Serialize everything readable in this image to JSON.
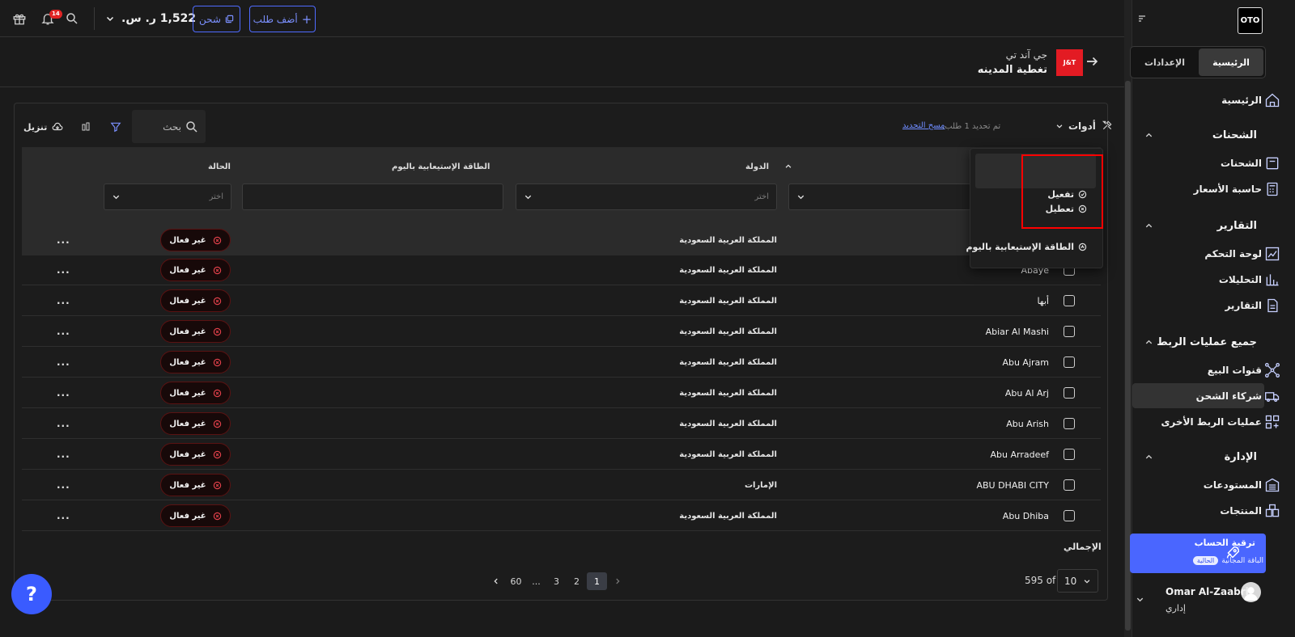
{
  "topbar": {
    "balance": "1,522 ر. س.",
    "ship_button": "شحن",
    "add_order_button": "أضف طلب",
    "notification_count": "14"
  },
  "carrier": {
    "logo_text": "J&T",
    "name": "جي آند تي",
    "page_title": "تغطية المدينه"
  },
  "toolbar": {
    "tools_label": "أدوات",
    "updated_text": "تم تحديد 1 طلب.",
    "clear_selection": "مسح التحديد",
    "search_placeholder": "بحث",
    "download_label": "تنزيل"
  },
  "table": {
    "headers": {
      "country": "الدولة",
      "capacity": "الطاقة الإستيعابية باليوم",
      "status": "الحالة"
    },
    "filter_placeholder": "اختر",
    "rows": [
      {
        "city": "",
        "country": "المملكة العربية السعودية",
        "status": "غير فعال"
      },
      {
        "city": "Abaye",
        "country": "المملكة العربية السعودية",
        "status": "غير فعال"
      },
      {
        "city": "أبها",
        "country": "المملكة العربية السعودية",
        "status": "غير فعال"
      },
      {
        "city": "Abiar Al Mashi",
        "country": "المملكة العربية السعودية",
        "status": "غير فعال"
      },
      {
        "city": "Abu Ajram",
        "country": "المملكة العربية السعودية",
        "status": "غير فعال"
      },
      {
        "city": "Abu Al Arj",
        "country": "المملكة العربية السعودية",
        "status": "غير فعال"
      },
      {
        "city": "Abu Arish",
        "country": "المملكة العربية السعودية",
        "status": "غير فعال"
      },
      {
        "city": "Abu Arradeef",
        "country": "المملكة العربية السعودية",
        "status": "غير فعال"
      },
      {
        "city": "ABU DHABI CITY",
        "country": "الإمارات",
        "status": "غير فعال"
      },
      {
        "city": "Abu Dhiba",
        "country": "المملكة العربية السعودية",
        "status": "غير فعال"
      }
    ],
    "more_label": "...",
    "total_label": "الإجمالي"
  },
  "menu": {
    "items": [
      "تفعيل",
      "تعطيل",
      "الطاقة الإستيعابية باليوم"
    ]
  },
  "pagination": {
    "pages": [
      "1",
      "2",
      "3",
      "...",
      "60"
    ],
    "active_page": "1",
    "per_page": "10",
    "total": "595 of"
  },
  "help_label": "?",
  "sidebar": {
    "logo": "OTO",
    "tabs": [
      "الرئيسية",
      "الإعدادات"
    ],
    "home": "الرئيسية",
    "sections": [
      {
        "title": "الشحنات",
        "items": [
          "الشحنات",
          "حاسبة الأسعار"
        ]
      },
      {
        "title": "التقارير",
        "items": [
          "لوحة التحكم",
          "التحليلات",
          "التقارير"
        ]
      },
      {
        "title": "جميع عمليات الربط",
        "items": [
          "قنوات البيع",
          "شركاء الشحن",
          "عمليات الربط الأخرى"
        ]
      },
      {
        "title": "الإدارة",
        "items": [
          "المستودعات",
          "المنتجات"
        ]
      }
    ],
    "upgrade": {
      "title": "ترقية الحساب",
      "plan": "الباقة المجانية",
      "badge": "الحالية"
    },
    "user": {
      "name": "Omar Al-Zaabri",
      "role": "إداري"
    }
  },
  "colors": {
    "accent": "#4a66ff",
    "danger": "#e0404a",
    "highlight": "#ff0000",
    "carrier": "#e31b23"
  }
}
